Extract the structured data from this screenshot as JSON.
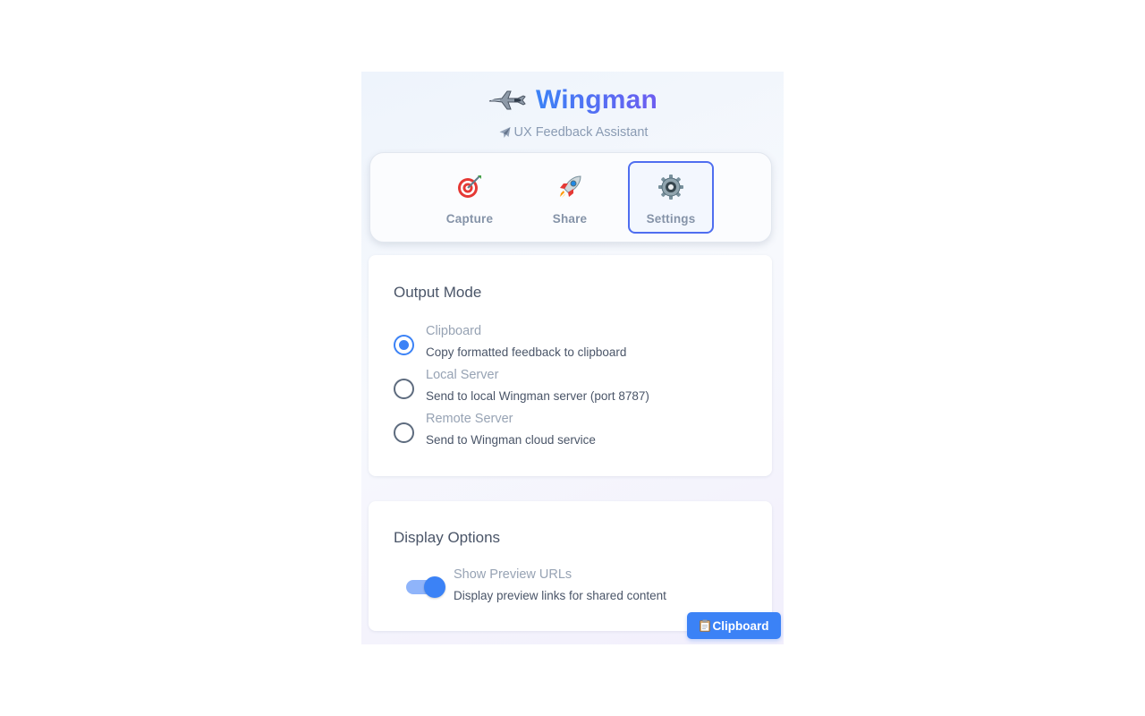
{
  "app": {
    "title": "Wingman",
    "subtitle": "UX Feedback Assistant",
    "logo_icon": "fighter-jet-icon",
    "subtitle_icon": "airplane-icon",
    "accent_color": "#3b82f6",
    "accent_secondary": "#6d5df0"
  },
  "tabs": [
    {
      "label": "Capture",
      "icon": "target-dart-icon",
      "active": false
    },
    {
      "label": "Share",
      "icon": "rocket-icon",
      "active": false
    },
    {
      "label": "Settings",
      "icon": "gear-icon",
      "active": true
    }
  ],
  "output_mode": {
    "title": "Output Mode",
    "selected": "Clipboard",
    "options": [
      {
        "label": "Clipboard",
        "description": "Copy formatted feedback to clipboard",
        "checked": true
      },
      {
        "label": "Local Server",
        "description": "Send to local Wingman server (port 8787)",
        "checked": false
      },
      {
        "label": "Remote Server",
        "description": "Send to Wingman cloud service",
        "checked": false
      }
    ]
  },
  "display_options": {
    "title": "Display Options",
    "toggle": {
      "label": "Show Preview URLs",
      "description": "Display preview links for shared content",
      "enabled": true
    }
  },
  "mode_badge": {
    "label": "Clipboard",
    "icon": "clipboard-icon"
  }
}
